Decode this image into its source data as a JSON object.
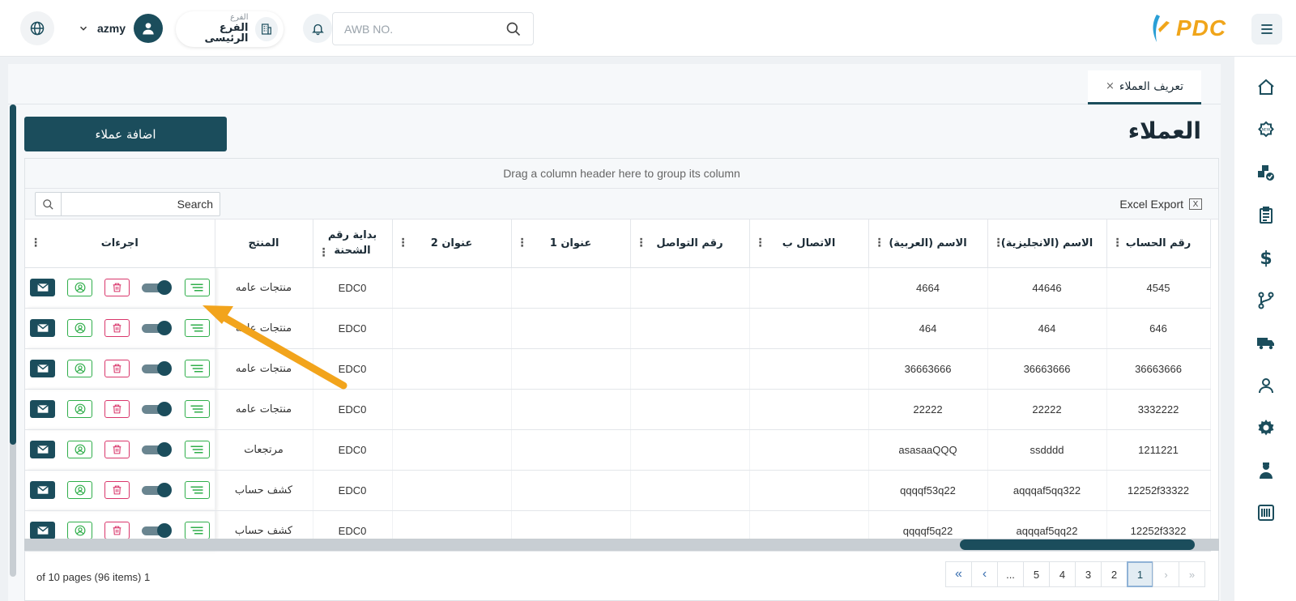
{
  "header": {
    "username": "azmy",
    "branch_label": "الفرع",
    "branch_value": "الفرع الرئيسى",
    "awb_placeholder": "AWB NO.",
    "logo_text": "PDC",
    "icons": [
      "globe-icon",
      "chevron-down-icon",
      "user-icon",
      "building-icon",
      "bell-icon",
      "search-icon",
      "menu-icon"
    ]
  },
  "sidebar": {
    "items": [
      "home-icon",
      "new-badge-icon",
      "boxes-check-icon",
      "clipboard-icon",
      "dollar-icon",
      "branches-icon",
      "truck-icon",
      "person-icon",
      "gear-icon",
      "agent-icon",
      "barcode-icon"
    ]
  },
  "tab": {
    "label": "تعريف العملاء",
    "close": "×"
  },
  "page": {
    "title": "العملاء",
    "add_button": "اضافة عملاء"
  },
  "grid": {
    "group_hint": "Drag a column header here to group its column",
    "search_placeholder": "Search",
    "excel_export": "Excel Export",
    "excel_icon": "X",
    "columns": {
      "actions": "اجرءات",
      "product": "المنتج",
      "awb_start": "بداية رقم الشحنة",
      "address2": "عنوان 2",
      "address1": "عنوان 1",
      "contact_no": "رقم التواصل",
      "contact_by": "الاتصال ب",
      "name_ar": "الاسم (العربية)",
      "name_en": "الاسم (الانجليزية)",
      "account_no": "رقم الحساب"
    },
    "rows": [
      {
        "product": "منتجات عامه",
        "awb_start": "EDC0",
        "address2": "",
        "address1": "",
        "contact_no": "",
        "contact_by": "",
        "name_ar": "4664",
        "name_en": "44646",
        "account_no": "4545"
      },
      {
        "product": "منتجات عامه",
        "awb_start": "EDC0",
        "address2": "",
        "address1": "",
        "contact_no": "",
        "contact_by": "",
        "name_ar": "464",
        "name_en": "464",
        "account_no": "646"
      },
      {
        "product": "منتجات عامه",
        "awb_start": "EDC0",
        "address2": "",
        "address1": "",
        "contact_no": "",
        "contact_by": "",
        "name_ar": "36663666",
        "name_en": "36663666",
        "account_no": "36663666"
      },
      {
        "product": "منتجات عامه",
        "awb_start": "EDC0",
        "address2": "",
        "address1": "",
        "contact_no": "",
        "contact_by": "",
        "name_ar": "22222",
        "name_en": "22222",
        "account_no": "3332222"
      },
      {
        "product": "مرتجعات",
        "awb_start": "EDC0",
        "address2": "",
        "address1": "",
        "contact_no": "",
        "contact_by": "",
        "name_ar": "asasaaQQQ",
        "name_en": "ssdddd",
        "account_no": "1211221"
      },
      {
        "product": "كشف حساب",
        "awb_start": "EDC0",
        "address2": "",
        "address1": "",
        "contact_no": "",
        "contact_by": "",
        "name_ar": "qqqqf53q22",
        "name_en": "aqqqaf5qq322",
        "account_no": "12252f33322"
      },
      {
        "product": "كشف حساب",
        "awb_start": "EDC0",
        "address2": "",
        "address1": "",
        "contact_no": "",
        "contact_by": "",
        "name_ar": "qqqqf5q22",
        "name_en": "aqqqaf5qq22",
        "account_no": "12252f3322"
      }
    ]
  },
  "pager": {
    "info": "of 10 pages (96 items) 1",
    "buttons": [
      "«",
      "‹",
      "...",
      "5",
      "4",
      "3",
      "2",
      "1",
      "›",
      "»"
    ],
    "active": "1"
  },
  "colors": {
    "primary": "#1b4d5c",
    "accent": "#f0a51a",
    "green": "#2fae4a",
    "pink": "#d9366b"
  }
}
